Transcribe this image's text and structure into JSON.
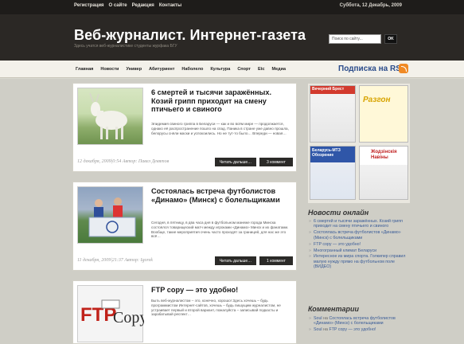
{
  "topbar": {
    "links": [
      "Регистрация",
      "О сайте",
      "Редакция",
      "Контакты"
    ],
    "date": "Суббота, 12 Декабрь, 2009"
  },
  "header": {
    "site_title": "Веб-журналист. Интернет-газета",
    "tagline": "Здесь учатся веб-журналистике студенты журфака БГУ",
    "search_placeholder": "Поиск по сайту...",
    "search_button": "OK"
  },
  "mainnav": {
    "items": [
      "Главная",
      "Новости",
      "Универ",
      "Абитуриент",
      "Наболело",
      "Культура",
      "Спорт",
      "Etc",
      "Медиа"
    ],
    "rss_label": "Подписка на RSS"
  },
  "posts": [
    {
      "title": "6 смертей и тысячи заражённых. Козий грипп приходит на смену птичьего и свиного",
      "excerpt": "Эпидемия свиного гриппа в Беларуси — как и во всём мире — продолжается, однако её распространение пошло на спад. Паника в стране уже давно прошла, белорусы сняли маски и успокоились. Но не тут-то было… Впереди — новая…",
      "meta": "12 декабря, 2009|0:54 Автор: Павел Девятов",
      "read_more": "Читать дальше…",
      "comments": "3 коммент"
    },
    {
      "title": "Состоялась встреча футболистов «Динамо» (Минск) с болельщиками",
      "excerpt": "Сегодня, в пятницу, в два часа дня в футбольном манеже города Минска состоялся товарищеский матч между игроками «Динамо» Минск и их фанатами. Вообще, такие мероприятия очень часто проходят за границей, для нас же это всё…",
      "meta": "11 декабря, 2009|21:37 Автор: Igorek",
      "read_more": "Читать дальше…",
      "comments": "1 коммент"
    },
    {
      "title": "FTP copy — это удобно!",
      "excerpt": "Быть веб-журналистом – это, конечно, хорошо! Здесь хочешь – будь программистом Интернет-сайтов, хочешь – будь пишущим журналистом, не устраивает первый и второй вариант, пожалуйста – записывай подкасты и зарабатывай респект…",
      "meta": "",
      "read_more": "",
      "comments": ""
    }
  ],
  "sidebar": {
    "news_title": "Новости онлайн",
    "news": [
      "6 смертей и тысячи заражённых. Козий грипп приходит на смену птичьего и свиного",
      "Состоялась встреча футболистов «Динамо» (Минск) с болельщиками",
      "FTP copy — это удобно!",
      "Многогранный климат Беларуси",
      "Интересное из мира спорта. Голкипер справил малую нужду прямо на футбольном поле (ВИДЕО)"
    ],
    "comments_title": "Комментарии",
    "comments": [
      {
        "who": "Soul",
        "on": "на",
        "post": "Состоялась встреча футболистов «Динамо» (Минск) с болельщиками"
      },
      {
        "who": "Soul",
        "on": "на",
        "post": "FTP copy — это удобно!"
      }
    ],
    "ads": [
      "Вечерний Брест",
      "Разгон",
      "Беларусь-МТЗ Обозрение",
      "Жодзінскія Навіны"
    ]
  },
  "colors": {
    "header_bg": "#2b2825",
    "topbar_bg": "#1e1c1a",
    "link": "#3a5c98",
    "rss": "#2a4b8a",
    "rss_icon": "#f08a24"
  },
  "icons": [
    "rss-icon"
  ]
}
